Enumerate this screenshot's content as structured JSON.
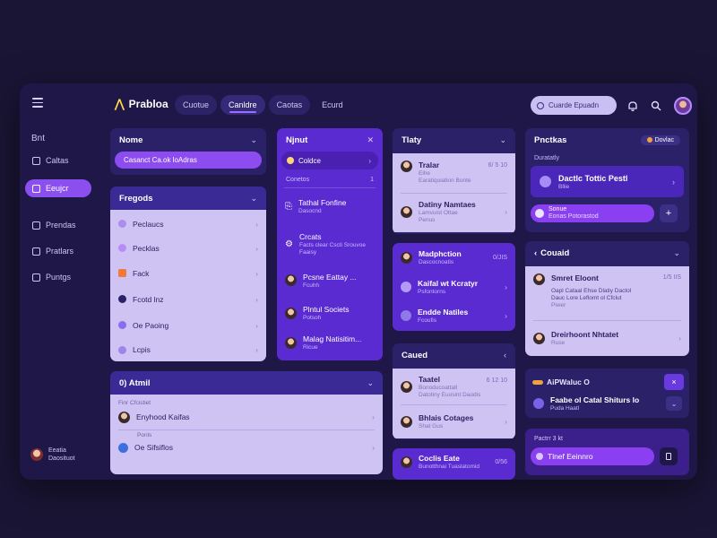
{
  "app": {
    "name": "Prabloa",
    "tabs": [
      "Cuotue",
      "Canldre",
      "Caotas",
      "Ecurd"
    ],
    "search_placeholder": "Cuarde Epuadn"
  },
  "sidebar": {
    "title": "Bnt",
    "items": [
      "Caltas",
      "Eeujcr",
      "Prendas",
      "Pratlars",
      "Puntgs"
    ],
    "user_name": "Eeatia",
    "user_sub": "Daosituot"
  },
  "col1": {
    "name_title": "Nome",
    "name_pill": "Casanct Ca.ok loAdras",
    "fregods_title": "Fregods",
    "fregods_items": [
      "Peclaucs",
      "Pecklas",
      "Fack",
      "Fcotd lnz",
      "Oe Paoing",
      "Lcpis"
    ],
    "atmil_title": "0) Atmil",
    "atmil_head": "Finr Cfcistiet",
    "atmil_rows": [
      {
        "label": "Enyhood Kaifas",
        "top": ""
      },
      {
        "label": "Oe Sifsiflos",
        "top": "Ponls"
      }
    ]
  },
  "col2": {
    "title": "Njnut",
    "top_pill": "Coldce",
    "sub_label": "Conetos",
    "sub_count": "1",
    "items": [
      {
        "title": "Tathal Fonfine",
        "sub": "Dasocnd"
      },
      {
        "title": "Crcats",
        "sub": "Facts clear Cscti Srouvoe",
        "sub2": "Faaisy"
      },
      {
        "title": "Pcsne Eattay ...",
        "sub": "Fcuhh"
      },
      {
        "title": "Plntul Societs",
        "sub": "Potsoh"
      },
      {
        "title": "Malag Natisitim...",
        "sub": "Ricue"
      }
    ]
  },
  "col3": {
    "title": "Tlaty",
    "top_items": [
      {
        "title": "Tralar",
        "meta": "6/ 5 10",
        "sub": "Eihe",
        "sub2": "Earatiquiation Bonte"
      },
      {
        "title": "Datiny Namtaes",
        "meta": "",
        "sub": "Lamvuist Ottae",
        "sub2": "Penus"
      }
    ],
    "mid_items": [
      {
        "title": "Madphction",
        "meta": "0/JIS",
        "sub": "Dascocnoatis"
      },
      {
        "title": "Kaifal wt Kcratyr",
        "meta": "",
        "sub": "Psfontorns"
      },
      {
        "title": "Endde Natiles",
        "meta": "",
        "sub": "Fcoufis"
      }
    ],
    "cated_title": "Caued",
    "cated_items": [
      {
        "title": "Taatel",
        "meta": "6 12 10",
        "sub": "Bonoducoattatl",
        "sub2": "Datotiny Euosint Daodis"
      },
      {
        "title": "Bhlais Cotages",
        "meta": "",
        "sub": "Shat Gus"
      }
    ],
    "bottom": {
      "title": "Coclis Eate",
      "meta": "0/56",
      "sub": "Bunotthnai Tuaslatomid"
    }
  },
  "col4": {
    "title": "Pnctkas",
    "badge": "Dovlac",
    "sub_label": "Duratatly",
    "card_title": "Dactlc Tottic Pestl",
    "card_sub": "Bllie",
    "pill_title": "Sonue",
    "pill_sub": "Eonas Potorastod",
    "plus": "+",
    "cound_title": "Couaid",
    "cound_items": [
      {
        "title": "Smret Eloont",
        "meta": "1/5 IIS",
        "line1": "Oapl Cataal Ehse Dlatiy Dactol",
        "line2": "Dauc Lore Leflomt ol Cfclut",
        "line3": "Piwer"
      },
      {
        "title": "Dreirhoont Nhtatet",
        "meta": "",
        "sub": "Ruse"
      }
    ],
    "aip_label": "AiPWaluc O",
    "close_icon": "×",
    "aip_item_title": "Faabe ol Catal Shiturs lo",
    "aip_item_sub": "Puda Haatl",
    "bottom_label": "Pactrr 3 kt",
    "bottom_pill": "Tlnef Eeinnro"
  },
  "colors": {
    "accent": "#8b4ff0",
    "bg": "#1e1747",
    "panel_dark": "#2a2168",
    "panel_light": "#cfc3f3"
  }
}
